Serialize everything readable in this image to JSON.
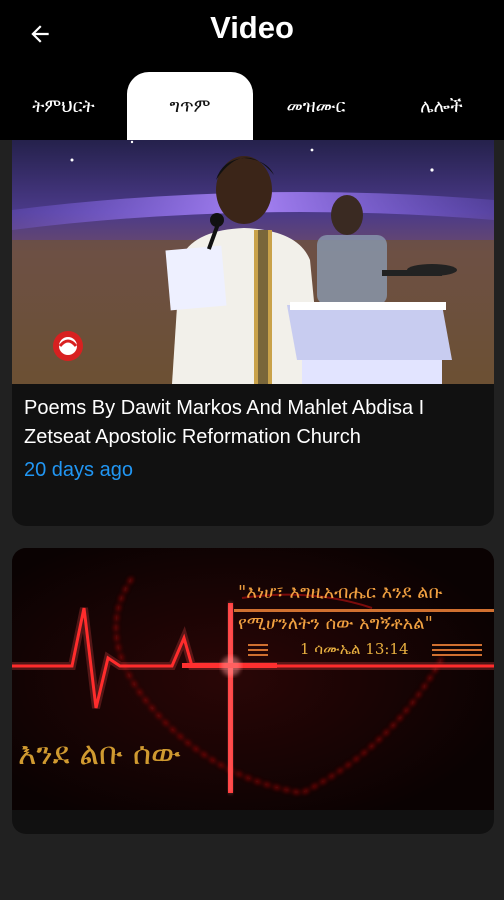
{
  "header": {
    "title": "Video"
  },
  "tabs": [
    {
      "label": "ትምህርት",
      "active": false
    },
    {
      "label": "ግጥም",
      "active": true
    },
    {
      "label": "መዝሙር",
      "active": false
    },
    {
      "label": "ሌሎች",
      "active": false
    }
  ],
  "videos": [
    {
      "title": "Poems By Dawit Markos And Mahlet Abdisa I Zetseat Apostolic Reformation Church",
      "age": "20 days ago"
    },
    {
      "title": "",
      "age": "",
      "thumb_quote_line1": "\"እነሆ፣ እግዚአብሔር እንደ ልቡ",
      "thumb_quote_line2": "የሚሆንለትን ሰው አግኝቶአል\"",
      "thumb_reference": "1 ሳሙኤል 13:14",
      "thumb_caption": "እንደ ልቡ ሰው"
    }
  ],
  "colors": {
    "accent": "#2196f3",
    "appbar": "#000000",
    "background": "#212121",
    "card": "#111111"
  }
}
